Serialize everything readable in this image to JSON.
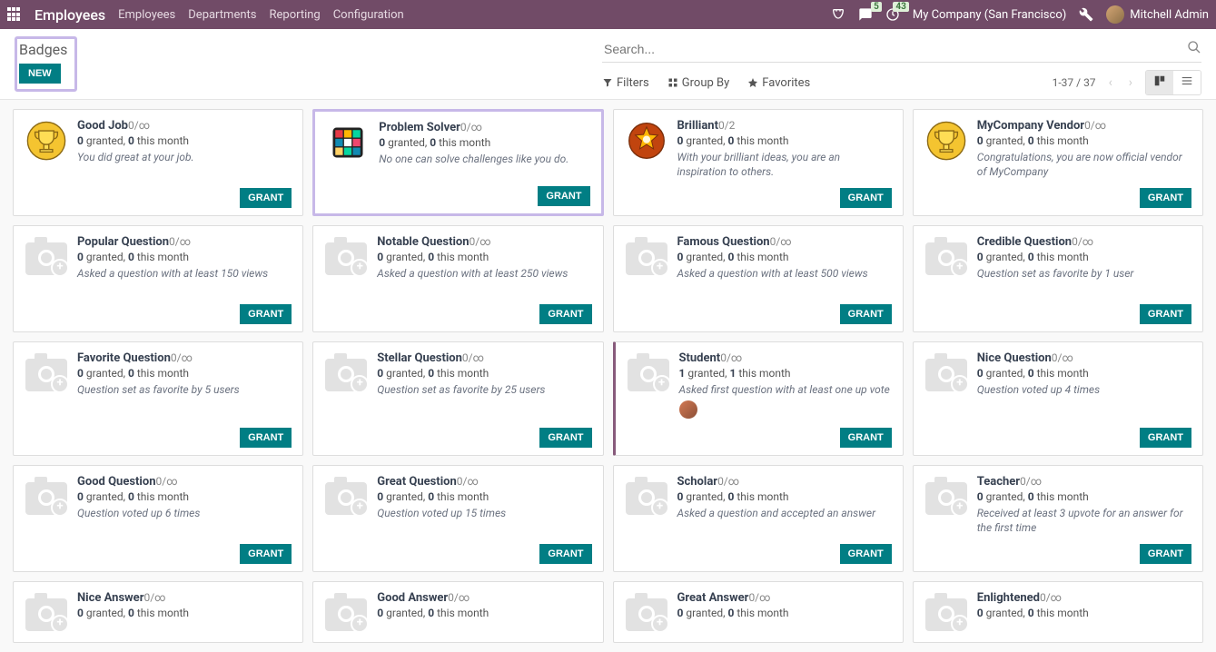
{
  "topbar": {
    "brand": "Employees",
    "nav": [
      "Employees",
      "Departments",
      "Reporting",
      "Configuration"
    ],
    "msg_count": "5",
    "activity_count": "43",
    "company": "My Company (San Francisco)",
    "user": "Mitchell Admin"
  },
  "control": {
    "title": "Badges",
    "new_label": "NEW",
    "search_placeholder": "Search...",
    "filters": "Filters",
    "groupby": "Group By",
    "favorites": "Favorites",
    "pager": "1-37 / 37"
  },
  "grant_label": "GRANT",
  "badges": [
    {
      "title": "Good Job",
      "limit": "0/∞",
      "g1": "0",
      "g2": "0",
      "desc": "You did great at your job.",
      "icon": "trophy"
    },
    {
      "title": "Problem Solver",
      "limit": "0/∞",
      "g1": "0",
      "g2": "0",
      "desc": "No one can solve challenges like you do.",
      "icon": "cube",
      "hl": true
    },
    {
      "title": "Brilliant",
      "limit": "0/2",
      "g1": "0",
      "g2": "0",
      "desc": "With your brilliant ideas, you are an inspiration to others.",
      "icon": "star"
    },
    {
      "title": "MyCompany Vendor",
      "limit": "0/∞",
      "g1": "0",
      "g2": "0",
      "desc": "Congratulations, you are now official vendor of MyCompany",
      "icon": "trophy"
    },
    {
      "title": "Popular Question",
      "limit": "0/∞",
      "g1": "0",
      "g2": "0",
      "desc": "Asked a question with at least 150 views",
      "icon": "camera"
    },
    {
      "title": "Notable Question",
      "limit": "0/∞",
      "g1": "0",
      "g2": "0",
      "desc": "Asked a question with at least 250 views",
      "icon": "camera"
    },
    {
      "title": "Famous Question",
      "limit": "0/∞",
      "g1": "0",
      "g2": "0",
      "desc": "Asked a question with at least 500 views",
      "icon": "camera"
    },
    {
      "title": "Credible Question",
      "limit": "0/∞",
      "g1": "0",
      "g2": "0",
      "desc": "Question set as favorite by 1 user",
      "icon": "camera"
    },
    {
      "title": "Favorite Question",
      "limit": "0/∞",
      "g1": "0",
      "g2": "0",
      "desc": "Question set as favorite by 5 users",
      "icon": "camera"
    },
    {
      "title": "Stellar Question",
      "limit": "0/∞",
      "g1": "0",
      "g2": "0",
      "desc": "Question set as favorite by 25 users",
      "icon": "camera"
    },
    {
      "title": "Student",
      "limit": "0/∞",
      "g1": "1",
      "g2": "1",
      "desc": "Asked first question with at least one up vote",
      "icon": "camera",
      "striped": true,
      "chip": true
    },
    {
      "title": "Nice Question",
      "limit": "0/∞",
      "g1": "0",
      "g2": "0",
      "desc": "Question voted up 4 times",
      "icon": "camera"
    },
    {
      "title": "Good Question",
      "limit": "0/∞",
      "g1": "0",
      "g2": "0",
      "desc": "Question voted up 6 times",
      "icon": "camera"
    },
    {
      "title": "Great Question",
      "limit": "0/∞",
      "g1": "0",
      "g2": "0",
      "desc": "Question voted up 15 times",
      "icon": "camera"
    },
    {
      "title": "Scholar",
      "limit": "0/∞",
      "g1": "0",
      "g2": "0",
      "desc": "Asked a question and accepted an answer",
      "icon": "camera"
    },
    {
      "title": "Teacher",
      "limit": "0/∞",
      "g1": "0",
      "g2": "0",
      "desc": "Received at least 3 upvote for an answer for the first time",
      "icon": "camera"
    },
    {
      "title": "Nice Answer",
      "limit": "0/∞",
      "g1": "0",
      "g2": "0",
      "desc": "",
      "icon": "camera",
      "short": true
    },
    {
      "title": "Good Answer",
      "limit": "0/∞",
      "g1": "0",
      "g2": "0",
      "desc": "",
      "icon": "camera",
      "short": true
    },
    {
      "title": "Great Answer",
      "limit": "0/∞",
      "g1": "0",
      "g2": "0",
      "desc": "",
      "icon": "camera",
      "short": true
    },
    {
      "title": "Enlightened",
      "limit": "0/∞",
      "g1": "0",
      "g2": "0",
      "desc": "",
      "icon": "camera",
      "short": true
    }
  ]
}
